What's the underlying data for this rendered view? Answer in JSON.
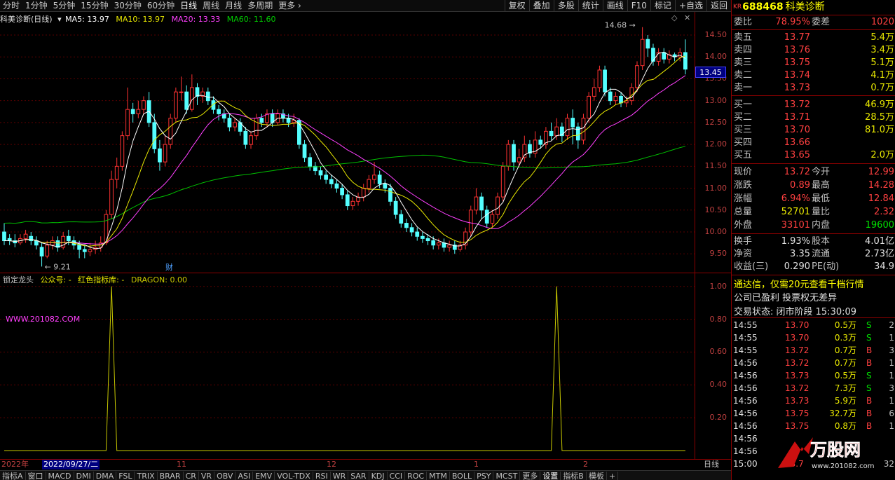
{
  "toolbar": {
    "periods": [
      "分时",
      "1分钟",
      "5分钟",
      "15分钟",
      "30分钟",
      "60分钟",
      "日线",
      "周线",
      "月线",
      "多周期",
      "更多"
    ],
    "active_period": "日线",
    "right_buttons": [
      "复权",
      "叠加",
      "多股",
      "统计",
      "画线",
      "F10",
      "标记",
      "+自选",
      "返回"
    ]
  },
  "chart_header": {
    "name": "科美诊断(日线)",
    "ma5": "MA5: 13.97",
    "ma10": "MA10: 13.97",
    "ma20": "MA20: 13.33",
    "ma60": "MA60: 11.60"
  },
  "annotations": {
    "high_label": "14.68",
    "low_label": "9.21",
    "finance_marker": "财"
  },
  "current_price_tag": "13.45",
  "indicator_header": {
    "name": "锁定龙头",
    "item1": "公众号: -",
    "item2": "红色指标库: -",
    "item3": "DRAGON: 0.00",
    "watermark": "WWW.201082.COM"
  },
  "chart_data": {
    "type": "candlestick",
    "price_axis_ticks": [
      "14.50",
      "14.00",
      "13.50",
      "13.00",
      "12.50",
      "12.00",
      "11.50",
      "11.00",
      "10.50",
      "10.00",
      "9.50"
    ],
    "price_range": [
      9.2,
      14.9
    ],
    "indicator_axis_ticks": [
      "1.00",
      "0.80",
      "0.60",
      "0.40",
      "0.20"
    ],
    "indicator_range": [
      0,
      1.05
    ],
    "series": [
      {
        "name": "MA5",
        "color": "#ffffff"
      },
      {
        "name": "MA10",
        "color": "#e8e800"
      },
      {
        "name": "MA20",
        "color": "#ff40ff"
      },
      {
        "name": "MA60",
        "color": "#00c000"
      },
      {
        "name": "DRAGON",
        "color": "#c8c800",
        "spikes_at_candle": [
          20,
          103
        ],
        "values": [
          1.0,
          1.0
        ]
      }
    ],
    "candles": [
      [
        10.0,
        9.8,
        10.2,
        9.7
      ],
      [
        9.85,
        9.8,
        9.95,
        9.7
      ],
      [
        9.8,
        9.75,
        9.95,
        9.65
      ],
      [
        9.75,
        9.85,
        9.95,
        9.7
      ],
      [
        9.85,
        9.95,
        10.05,
        9.75
      ],
      [
        9.9,
        9.8,
        10.0,
        9.7
      ],
      [
        9.8,
        9.7,
        9.9,
        9.6
      ],
      [
        9.65,
        9.45,
        9.75,
        9.21
      ],
      [
        9.45,
        9.7,
        9.8,
        9.4
      ],
      [
        9.7,
        9.8,
        9.9,
        9.6
      ],
      [
        9.8,
        9.65,
        9.9,
        9.55
      ],
      [
        9.65,
        9.9,
        10.0,
        9.6
      ],
      [
        9.9,
        9.8,
        10.05,
        9.7
      ],
      [
        9.8,
        9.7,
        9.9,
        9.6
      ],
      [
        9.7,
        9.6,
        9.8,
        9.4
      ],
      [
        9.6,
        9.55,
        9.7,
        9.4
      ],
      [
        9.55,
        9.6,
        9.75,
        9.45
      ],
      [
        9.6,
        9.65,
        9.8,
        9.5
      ],
      [
        9.65,
        9.75,
        9.9,
        9.55
      ],
      [
        9.75,
        10.4,
        10.5,
        9.7
      ],
      [
        10.4,
        11.2,
        11.4,
        10.3
      ],
      [
        11.2,
        11.5,
        11.7,
        11.0
      ],
      [
        11.5,
        12.2,
        12.3,
        11.4
      ],
      [
        12.2,
        12.8,
        13.3,
        12.1
      ],
      [
        12.8,
        12.7,
        12.95,
        12.5
      ],
      [
        12.7,
        12.8,
        13.0,
        12.6
      ],
      [
        12.8,
        13.0,
        13.1,
        12.7
      ],
      [
        13.0,
        12.5,
        13.2,
        12.4
      ],
      [
        12.5,
        11.9,
        12.7,
        11.8
      ],
      [
        11.9,
        11.6,
        12.1,
        11.4
      ],
      [
        11.6,
        12.0,
        12.2,
        11.5
      ],
      [
        12.0,
        12.6,
        12.7,
        11.9
      ],
      [
        12.6,
        13.2,
        13.3,
        12.5
      ],
      [
        13.2,
        13.2,
        13.55,
        13.0
      ],
      [
        13.2,
        12.8,
        13.35,
        12.7
      ],
      [
        12.8,
        13.3,
        13.6,
        12.75
      ],
      [
        13.3,
        13.1,
        13.4,
        12.9
      ],
      [
        13.1,
        13.2,
        13.3,
        12.95
      ],
      [
        13.2,
        13.0,
        13.3,
        12.9
      ],
      [
        13.0,
        12.8,
        13.1,
        12.7
      ],
      [
        12.8,
        12.7,
        12.9,
        12.55
      ],
      [
        12.7,
        12.6,
        12.8,
        12.5
      ],
      [
        12.6,
        12.4,
        12.7,
        12.3
      ],
      [
        12.4,
        12.5,
        12.6,
        12.3
      ],
      [
        12.5,
        12.3,
        12.6,
        12.2
      ],
      [
        12.3,
        12.0,
        12.4,
        11.9
      ],
      [
        12.0,
        12.2,
        12.3,
        11.9
      ],
      [
        12.2,
        12.6,
        12.7,
        12.1
      ],
      [
        12.6,
        12.5,
        12.7,
        12.4
      ],
      [
        12.5,
        12.7,
        12.8,
        12.4
      ],
      [
        12.7,
        12.5,
        12.8,
        12.4
      ],
      [
        12.5,
        12.7,
        12.8,
        12.45
      ],
      [
        12.7,
        12.6,
        12.8,
        12.5
      ],
      [
        12.6,
        12.5,
        12.7,
        12.4
      ],
      [
        12.5,
        12.55,
        12.7,
        12.4
      ],
      [
        12.55,
        12.0,
        12.6,
        11.9
      ],
      [
        12.0,
        11.7,
        12.1,
        11.6
      ],
      [
        11.7,
        11.5,
        11.8,
        11.4
      ],
      [
        11.5,
        11.4,
        11.6,
        11.3
      ],
      [
        11.4,
        11.3,
        11.5,
        11.2
      ],
      [
        11.3,
        11.2,
        11.4,
        11.1
      ],
      [
        11.2,
        11.1,
        11.3,
        11.0
      ],
      [
        11.1,
        11.0,
        11.2,
        10.9
      ],
      [
        11.0,
        10.85,
        11.1,
        10.75
      ],
      [
        10.85,
        10.6,
        10.95,
        10.5
      ],
      [
        10.6,
        10.7,
        10.8,
        10.5
      ],
      [
        10.7,
        10.8,
        10.9,
        10.6
      ],
      [
        10.8,
        11.0,
        11.1,
        10.7
      ],
      [
        11.0,
        11.2,
        11.3,
        10.9
      ],
      [
        11.2,
        11.3,
        11.6,
        11.1
      ],
      [
        11.3,
        11.1,
        11.4,
        11.0
      ],
      [
        11.1,
        11.0,
        11.2,
        10.9
      ],
      [
        11.0,
        10.7,
        11.1,
        10.6
      ],
      [
        10.7,
        10.4,
        10.8,
        10.3
      ],
      [
        10.4,
        10.2,
        10.5,
        10.1
      ],
      [
        10.2,
        10.1,
        10.3,
        10.0
      ],
      [
        10.1,
        10.0,
        10.2,
        9.9
      ],
      [
        10.0,
        9.9,
        10.1,
        9.8
      ],
      [
        9.9,
        9.85,
        10.0,
        9.75
      ],
      [
        9.85,
        9.8,
        9.95,
        9.7
      ],
      [
        9.8,
        9.7,
        9.9,
        9.6
      ],
      [
        9.7,
        9.75,
        9.85,
        9.6
      ],
      [
        9.75,
        9.65,
        9.85,
        9.55
      ],
      [
        9.65,
        9.7,
        9.8,
        9.55
      ],
      [
        9.7,
        9.6,
        9.8,
        9.5
      ],
      [
        9.6,
        9.7,
        9.8,
        9.55
      ],
      [
        9.7,
        10.0,
        10.1,
        9.6
      ],
      [
        10.0,
        10.5,
        10.6,
        9.9
      ],
      [
        10.5,
        10.8,
        11.0,
        10.4
      ],
      [
        10.8,
        10.5,
        10.9,
        10.3
      ],
      [
        10.5,
        10.2,
        10.6,
        10.1
      ],
      [
        10.2,
        10.4,
        10.5,
        10.1
      ],
      [
        10.4,
        10.8,
        10.9,
        10.3
      ],
      [
        10.8,
        11.5,
        11.6,
        10.7
      ],
      [
        11.5,
        12.0,
        12.1,
        11.4
      ],
      [
        12.0,
        11.6,
        12.1,
        11.4
      ],
      [
        11.6,
        11.7,
        11.9,
        11.5
      ],
      [
        11.7,
        12.0,
        12.2,
        11.6
      ],
      [
        12.0,
        11.8,
        12.1,
        11.7
      ],
      [
        11.8,
        12.1,
        12.3,
        11.7
      ],
      [
        12.1,
        12.0,
        12.2,
        11.9
      ],
      [
        12.0,
        12.3,
        12.4,
        11.9
      ],
      [
        12.3,
        12.2,
        12.5,
        12.1
      ],
      [
        12.2,
        12.4,
        12.6,
        12.1
      ],
      [
        12.4,
        12.2,
        12.5,
        12.05
      ],
      [
        12.2,
        12.6,
        12.7,
        12.1
      ],
      [
        12.6,
        12.4,
        12.8,
        12.0
      ],
      [
        12.4,
        12.1,
        12.5,
        11.9
      ],
      [
        12.1,
        12.6,
        12.7,
        12.0
      ],
      [
        12.6,
        13.1,
        13.2,
        12.5
      ],
      [
        13.1,
        13.3,
        13.5,
        13.0
      ],
      [
        13.3,
        13.7,
        13.8,
        13.2
      ],
      [
        13.7,
        13.2,
        13.8,
        13.1
      ],
      [
        13.2,
        13.0,
        13.3,
        12.9
      ],
      [
        13.0,
        13.1,
        13.2,
        12.9
      ],
      [
        13.1,
        12.95,
        13.2,
        12.85
      ],
      [
        12.95,
        13.0,
        13.1,
        12.85
      ],
      [
        13.0,
        13.3,
        13.4,
        12.9
      ],
      [
        13.3,
        13.8,
        13.9,
        13.2
      ],
      [
        13.8,
        14.4,
        14.68,
        13.7
      ],
      [
        14.4,
        14.2,
        14.5,
        14.0
      ],
      [
        14.2,
        13.9,
        14.3,
        13.8
      ],
      [
        13.9,
        14.1,
        14.2,
        13.8
      ],
      [
        14.1,
        13.95,
        14.2,
        13.85
      ],
      [
        13.95,
        14.05,
        14.15,
        13.85
      ],
      [
        14.05,
        14.0,
        14.1,
        13.9
      ],
      [
        14.0,
        14.1,
        14.2,
        13.9
      ],
      [
        14.1,
        13.72,
        14.4,
        13.6
      ]
    ],
    "date_labels": [
      "2022年",
      "2022/09/27/二",
      "11",
      "12",
      "1",
      "2"
    ],
    "period_label": "日线"
  },
  "bottom_tabs": [
    "指标A",
    "窗口",
    "MACD",
    "DMI",
    "DMA",
    "FSL",
    "TRIX",
    "BRAR",
    "CR",
    "VR",
    "OBV",
    "ASI",
    "EMV",
    "VOL-TDX",
    "RSI",
    "WR",
    "SAR",
    "KDJ",
    "CCI",
    "ROC",
    "MTM",
    "BOLL",
    "PSY",
    "MCST",
    "更多",
    "设置",
    "指标B",
    "模板",
    "+"
  ],
  "quote_panel": {
    "code": "688468",
    "stock_name": "科美诊断",
    "prefix": "KR",
    "weibi_label": "委比",
    "weibi_value": "78.95%",
    "weicha_label": "委差",
    "weicha_value": "1020",
    "asks": [
      {
        "label": "卖五",
        "price": "13.77",
        "vol": "5.4万"
      },
      {
        "label": "卖四",
        "price": "13.76",
        "vol": "3.4万"
      },
      {
        "label": "卖三",
        "price": "13.75",
        "vol": "5.1万"
      },
      {
        "label": "卖二",
        "price": "13.74",
        "vol": "4.1万"
      },
      {
        "label": "卖一",
        "price": "13.73",
        "vol": "0.7万"
      }
    ],
    "bids": [
      {
        "label": "买一",
        "price": "13.72",
        "vol": "46.9万"
      },
      {
        "label": "买二",
        "price": "13.71",
        "vol": "28.5万"
      },
      {
        "label": "买三",
        "price": "13.70",
        "vol": "81.0万"
      },
      {
        "label": "买四",
        "price": "13.66",
        "vol": ""
      },
      {
        "label": "买五",
        "price": "13.65",
        "vol": "2.0万"
      }
    ],
    "stats": [
      {
        "l1": "现价",
        "v1": "13.72",
        "l2": "今开",
        "v2": "12.99"
      },
      {
        "l1": "涨跌",
        "v1": "0.89",
        "l2": "最高",
        "v2": "14.28"
      },
      {
        "l1": "涨幅",
        "v1": "6.94%",
        "l2": "最低",
        "v2": "12.84"
      },
      {
        "l1": "总量",
        "v1": "52701",
        "l2": "量比",
        "v2": "2.32"
      },
      {
        "l1": "外盘",
        "v1": "33101",
        "l2": "内盘",
        "v2": "19600"
      }
    ],
    "stats2": [
      {
        "l1": "换手",
        "v1": "1.93%",
        "l2": "股本",
        "v2": "4.01亿"
      },
      {
        "l1": "净资",
        "v1": "3.35",
        "l2": "流通",
        "v2": "2.73亿"
      },
      {
        "l1": "收益(三)",
        "v1": "0.290",
        "l2": "PE(动)",
        "v2": "34.9"
      }
    ],
    "promo": "通达信，仅需20元查看千档行情",
    "notice": "公司已盈利 投票权无差异",
    "trade_status": "交易状态: 闭市阶段 15:30:09",
    "ticks": [
      {
        "t": "14:55",
        "p": "13.70",
        "v": "0.5万",
        "s": "S",
        "n": "2"
      },
      {
        "t": "14:55",
        "p": "13.70",
        "v": "0.3万",
        "s": "S",
        "n": "1"
      },
      {
        "t": "14:55",
        "p": "13.72",
        "v": "0.7万",
        "s": "B",
        "n": "3"
      },
      {
        "t": "14:56",
        "p": "13.72",
        "v": "0.7万",
        "s": "B",
        "n": "1"
      },
      {
        "t": "14:56",
        "p": "13.73",
        "v": "0.5万",
        "s": "S",
        "n": "1"
      },
      {
        "t": "14:56",
        "p": "13.72",
        "v": "7.3万",
        "s": "S",
        "n": "3"
      },
      {
        "t": "14:56",
        "p": "13.73",
        "v": "5.9万",
        "s": "B",
        "n": "1"
      },
      {
        "t": "14:56",
        "p": "13.75",
        "v": "32.7万",
        "s": "B",
        "n": "6"
      },
      {
        "t": "14:56",
        "p": "13.75",
        "v": "0.8万",
        "s": "B",
        "n": "1"
      },
      {
        "t": "14:56",
        "p": "",
        "v": "",
        "s": "",
        "n": ""
      },
      {
        "t": "14:56",
        "p": "",
        "v": "",
        "s": "",
        "n": ""
      },
      {
        "t": "15:00",
        "p": "13.7",
        "v": "",
        "s": "",
        "n": "32"
      }
    ],
    "logo_text": "万股网",
    "logo_url": "www.201082.com"
  }
}
